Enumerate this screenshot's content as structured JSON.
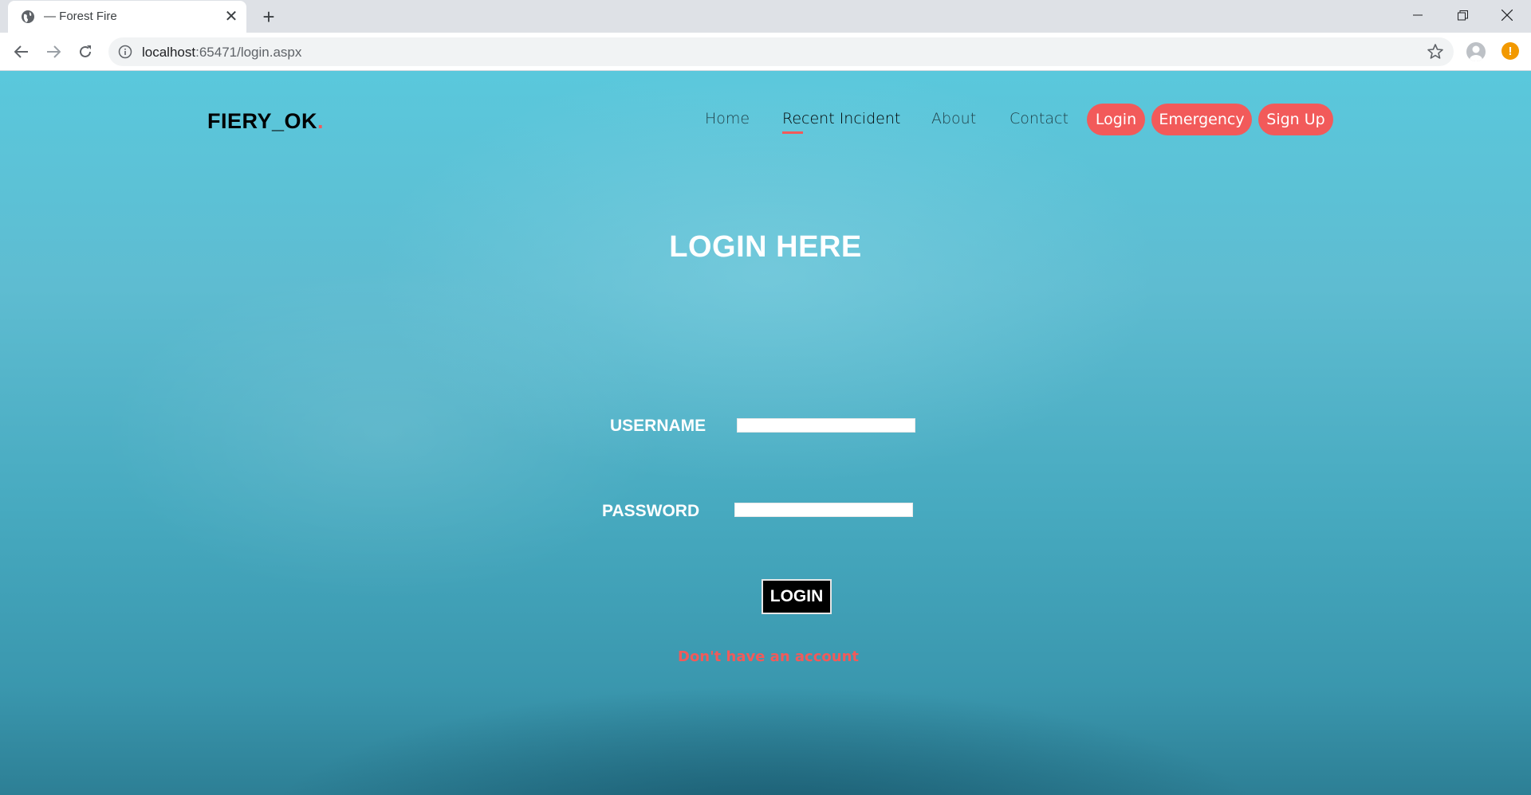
{
  "browser": {
    "tab_title": "— Forest Fire",
    "url_host": "localhost",
    "url_rest": ":65471/login.aspx"
  },
  "site": {
    "brand": "FIERY_OK",
    "brand_dot": ".",
    "nav": {
      "home": "Home",
      "recent_incident": "Recent Incident",
      "about": "About",
      "contact": "Contact",
      "login": "Login",
      "emergency": "Emergency",
      "signup": "Sign Up"
    }
  },
  "login_form": {
    "title": "LOGIN HERE",
    "username_label": "USERNAME",
    "username_value": "",
    "password_label": "PASSWORD",
    "password_value": "",
    "submit_label": "LOGIN",
    "no_account_link": "Don't have an account"
  },
  "colors": {
    "accent": "#f25a5a",
    "background": "#5ebcd1"
  }
}
